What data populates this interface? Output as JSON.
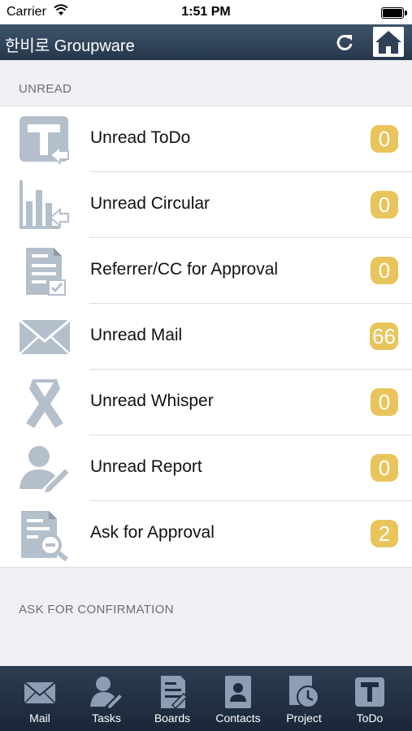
{
  "status_bar": {
    "carrier": "Carrier",
    "time": "1:51 PM"
  },
  "nav": {
    "title": "한비로 Groupware"
  },
  "sections": {
    "unread": "UNREAD",
    "ask": "ASK FOR CONFIRMATION"
  },
  "items": [
    {
      "label": "Unread ToDo",
      "count": "0",
      "icon": "todo-icon"
    },
    {
      "label": "Unread Circular",
      "count": "0",
      "icon": "circular-chart-icon"
    },
    {
      "label": "Referrer/CC for Approval",
      "count": "0",
      "icon": "approval-document-icon"
    },
    {
      "label": "Unread Mail",
      "count": "66",
      "icon": "mail-envelope-icon"
    },
    {
      "label": "Unread Whisper",
      "count": "0",
      "icon": "whisper-ribbon-icon"
    },
    {
      "label": "Unread Report",
      "count": "0",
      "icon": "report-user-pencil-icon"
    },
    {
      "label": "Ask for Approval",
      "count": "2",
      "icon": "search-document-icon"
    }
  ],
  "tabs": [
    {
      "label": "Mail",
      "icon": "mail-icon"
    },
    {
      "label": "Tasks",
      "icon": "tasks-icon"
    },
    {
      "label": "Boards",
      "icon": "boards-icon"
    },
    {
      "label": "Contacts",
      "icon": "contacts-icon"
    },
    {
      "label": "Project",
      "icon": "project-clock-icon"
    },
    {
      "label": "ToDo",
      "icon": "todo-icon"
    }
  ],
  "colors": {
    "nav": "#2f4158",
    "badge": "#e9c45a",
    "icon_gray": "#b4bfcc",
    "tabbar": "#1f2b3e"
  }
}
